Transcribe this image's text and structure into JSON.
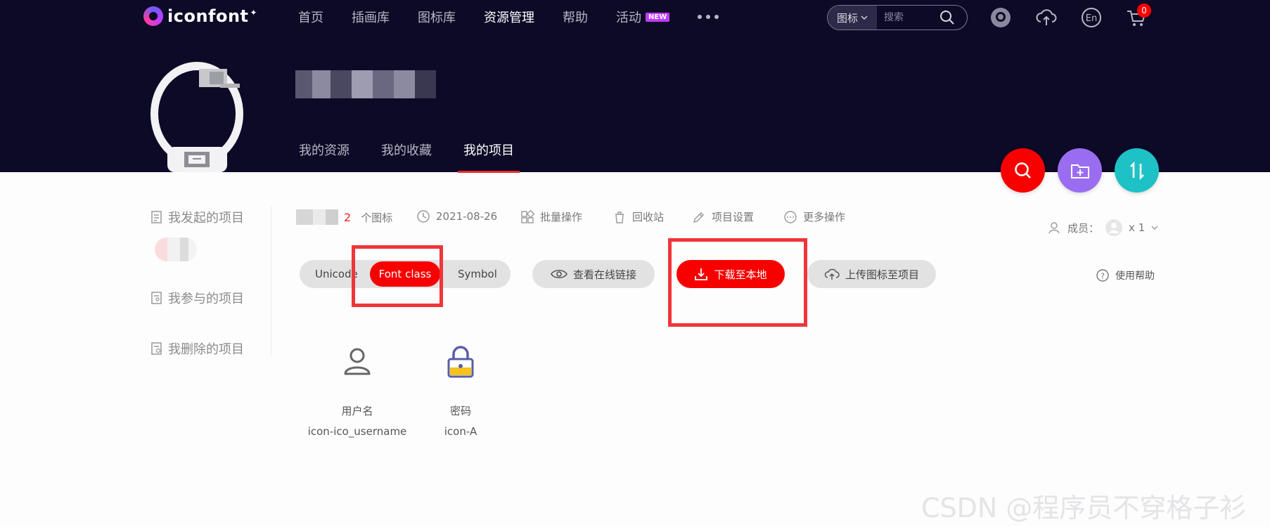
{
  "header": {
    "logo_text": "iconfont",
    "nav": [
      {
        "label": "首页"
      },
      {
        "label": "插画库"
      },
      {
        "label": "图标库"
      },
      {
        "label": "资源管理"
      },
      {
        "label": "帮助"
      },
      {
        "label": "活动",
        "badge": "NEW"
      }
    ],
    "search": {
      "type": "图标",
      "placeholder": "搜索"
    },
    "cart_count": "0",
    "sub_nav": [
      "我的资源",
      "我的收藏",
      "我的项目"
    ]
  },
  "sidebar": {
    "items": [
      "我发起的项目",
      "我参与的项目",
      "我删除的项目"
    ]
  },
  "project": {
    "count": "2",
    "count_label": "个图标",
    "date": "2021-08-26",
    "actions": [
      "批量操作",
      "回收站",
      "项目设置",
      "更多操作"
    ],
    "members_label": "成员：",
    "members_count": "x 1"
  },
  "toolbar": {
    "formats": [
      "Unicode",
      "Font class",
      "Symbol"
    ],
    "active_format": "Font class",
    "view_link": "查看在线链接",
    "download": "下载至本地",
    "upload": "上传图标至项目",
    "help": "使用帮助"
  },
  "icons": [
    {
      "name": "用户名",
      "code": "icon-ico_username",
      "icon": "user-icon"
    },
    {
      "name": "密码",
      "code": "icon-A",
      "icon": "lock-icon"
    }
  ],
  "colors": {
    "header_bg": "#0c0a26",
    "accent_red": "#f80000",
    "highlight_box": "#f0353a",
    "fab_purple": "#9a6df0",
    "fab_teal": "#1ec1c6"
  },
  "watermark": "CSDN @程序员不穿格子衫"
}
